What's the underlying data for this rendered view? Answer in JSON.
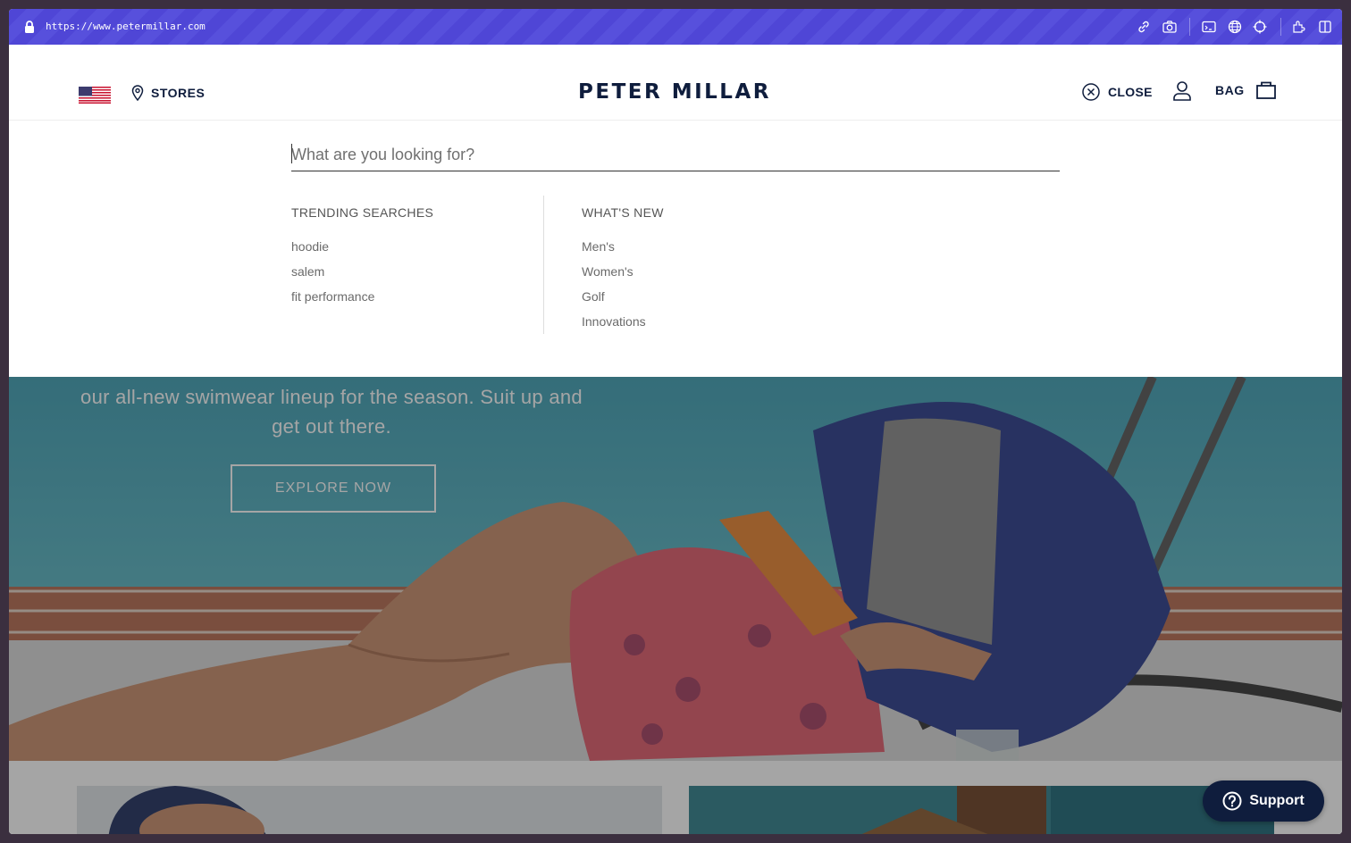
{
  "browser": {
    "url": "https://www.petermillar.com",
    "toolbar_icons": [
      "link-icon",
      "camera-icon",
      "terminal-icon",
      "globe-icon",
      "crosshair-icon",
      "extension-icon",
      "sidebar-icon"
    ]
  },
  "header": {
    "region_flag": "us-flag-icon",
    "stores_label": "STORES",
    "logo_text": "PETER MILLAR",
    "close_label": "CLOSE",
    "bag_label": "BAG"
  },
  "search": {
    "placeholder": "What are you looking for?",
    "value": ""
  },
  "trending": {
    "title": "TRENDING SEARCHES",
    "items": [
      "hoodie",
      "salem",
      "fit performance"
    ]
  },
  "whats_new": {
    "title": "WHAT'S NEW",
    "items": [
      "Men's",
      "Women's",
      "Golf",
      "Innovations"
    ]
  },
  "hero": {
    "text": "our all-new swimwear lineup for the season. Suit up and get out there.",
    "cta_label": "EXPLORE NOW"
  },
  "support": {
    "label": "Support"
  },
  "colors": {
    "brand_navy": "#0f1d3d",
    "browser_bar": "#4f46d6",
    "pool_teal": "#3aa3b5"
  }
}
